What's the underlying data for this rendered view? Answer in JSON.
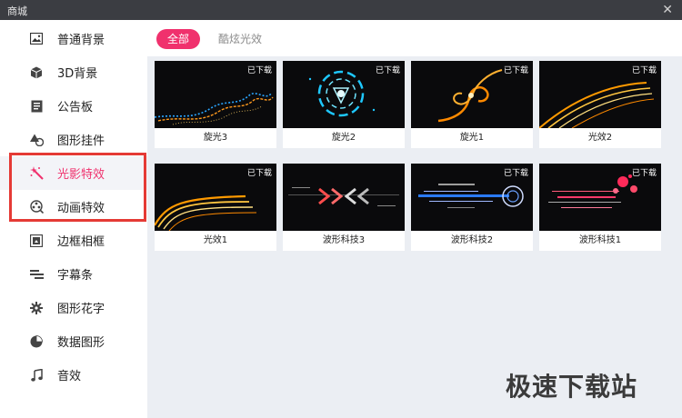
{
  "window": {
    "title": "商城"
  },
  "sidebar": {
    "items": [
      {
        "label": "普通背景",
        "icon": "image-icon"
      },
      {
        "label": "3D背景",
        "icon": "cube-icon"
      },
      {
        "label": "公告板",
        "icon": "notice-board-icon"
      },
      {
        "label": "图形挂件",
        "icon": "shapes-icon"
      },
      {
        "label": "光影特效",
        "icon": "sparkle-icon",
        "active": true
      },
      {
        "label": "动画特效",
        "icon": "animation-reel-icon"
      },
      {
        "label": "边框相框",
        "icon": "frame-icon"
      },
      {
        "label": "字幕条",
        "icon": "subtitle-bar-icon"
      },
      {
        "label": "图形花字",
        "icon": "gear-flower-icon"
      },
      {
        "label": "数据图形",
        "icon": "pie-chart-icon"
      },
      {
        "label": "音效",
        "icon": "music-note-icon"
      }
    ]
  },
  "tabs": {
    "all": "全部",
    "cool": "酷炫光效"
  },
  "cards": [
    {
      "caption": "旋光3",
      "badge": "已下载"
    },
    {
      "caption": "旋光2",
      "badge": "已下载"
    },
    {
      "caption": "旋光1",
      "badge": "已下载"
    },
    {
      "caption": "光效2",
      "badge": "已下载"
    },
    {
      "caption": "光效1",
      "badge": "已下载"
    },
    {
      "caption": "波形科技3",
      "badge": ""
    },
    {
      "caption": "波形科技2",
      "badge": "已下载"
    },
    {
      "caption": "波形科技1",
      "badge": "已下载"
    }
  ],
  "watermark": "极速下载站",
  "colors": {
    "accent": "#f0316d",
    "highlight": "#e53a35",
    "titlebar": "#3b3d42"
  }
}
